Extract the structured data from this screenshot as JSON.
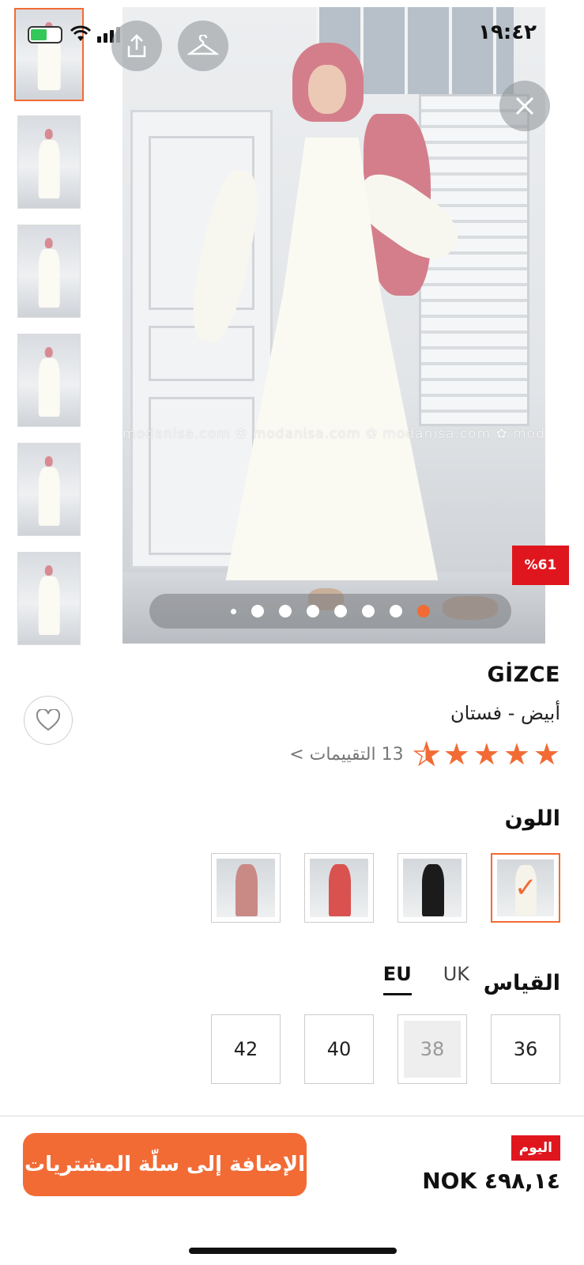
{
  "status_bar": {
    "time": "١٩:٤٢"
  },
  "gallery": {
    "thumbnail_count": 6,
    "selected_thumbnail": 1,
    "watermark": "modanisa.com ✿ modanisa.com ✿ modanisa.com ✿ modanisa.com ✿",
    "discount_badge": "%61",
    "dot_count": 8,
    "active_dot": 8
  },
  "product": {
    "brand": "GİZCE",
    "subtitle": "أبيض - فستان",
    "rating_stars": 4.5,
    "reviews_label": "13 التقييمات >"
  },
  "color": {
    "title": "اللون",
    "swatches": [
      {
        "color_hint": "#f5f3ea",
        "selected": true
      },
      {
        "color_hint": "#1b1b1b",
        "selected": false
      },
      {
        "color_hint": "#d9524f",
        "selected": false
      },
      {
        "color_hint": "#c98a86",
        "selected": false
      }
    ]
  },
  "size": {
    "title": "القياس",
    "tabs": [
      "UK",
      "EU"
    ],
    "active_tab": "EU",
    "options": [
      {
        "label": "36",
        "available": true
      },
      {
        "label": "38",
        "available": false
      },
      {
        "label": "40",
        "available": true
      },
      {
        "label": "42",
        "available": true
      }
    ]
  },
  "purchase": {
    "today_label": "اليوم",
    "price": "NOK ٤٩٨,١٤",
    "add_to_cart": "الإضافة إلى سلّة المشتريات"
  },
  "colors": {
    "accent": "#f26b35",
    "sale_red": "#e0161e"
  }
}
